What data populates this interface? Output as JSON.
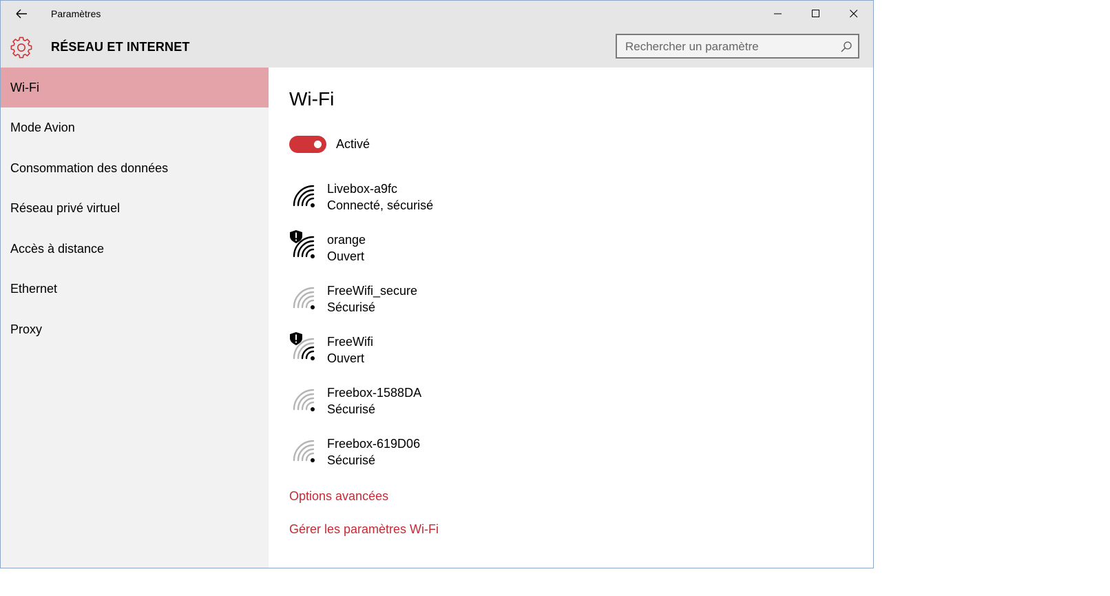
{
  "window": {
    "app_title": "Paramètres",
    "section_title": "RÉSEAU ET INTERNET"
  },
  "search": {
    "placeholder": "Rechercher un paramètre"
  },
  "sidebar": {
    "items": [
      {
        "label": "Wi-Fi",
        "selected": true
      },
      {
        "label": "Mode Avion",
        "selected": false
      },
      {
        "label": "Consommation des données",
        "selected": false
      },
      {
        "label": "Réseau privé virtuel",
        "selected": false
      },
      {
        "label": "Accès à distance",
        "selected": false
      },
      {
        "label": "Ethernet",
        "selected": false
      },
      {
        "label": "Proxy",
        "selected": false
      }
    ]
  },
  "main": {
    "title": "Wi-Fi",
    "toggle": {
      "state": "on",
      "label": "Activé"
    },
    "networks": [
      {
        "name": "Livebox-a9fc",
        "status": "Connecté, sécurisé",
        "signal_bars": 4,
        "open_warning": false
      },
      {
        "name": "orange",
        "status": "Ouvert",
        "signal_bars": 4,
        "open_warning": true
      },
      {
        "name": "FreeWifi_secure",
        "status": "Sécurisé",
        "signal_bars": 1,
        "open_warning": false
      },
      {
        "name": "FreeWifi",
        "status": "Ouvert",
        "signal_bars": 2,
        "open_warning": true
      },
      {
        "name": "Freebox-1588DA",
        "status": "Sécurisé",
        "signal_bars": 1,
        "open_warning": false
      },
      {
        "name": "Freebox-619D06",
        "status": "Sécurisé",
        "signal_bars": 1,
        "open_warning": false
      }
    ],
    "links": {
      "advanced": "Options avancées",
      "manage": "Gérer les paramètres Wi-Fi"
    }
  },
  "colors": {
    "accent": "#d13438",
    "link": "#c42b36",
    "selected_nav": "#e4a3a8",
    "header_bg": "#e6e6e6",
    "sidebar_bg": "#f2f2f2"
  }
}
